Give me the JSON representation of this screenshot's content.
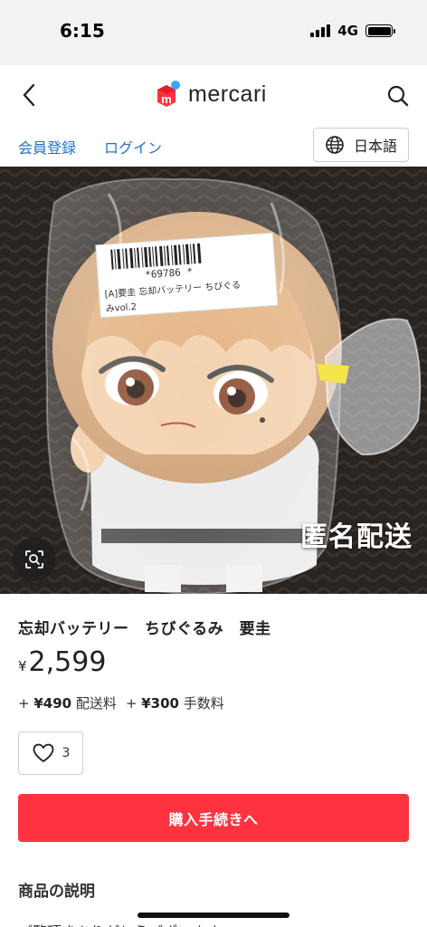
{
  "status_bar": {
    "time": "6:15",
    "network": "4G"
  },
  "header": {
    "logo_text": "mercari",
    "logo_mark": "m"
  },
  "subnav": {
    "register": "会員登録",
    "login": "ログイン",
    "language": "日本語"
  },
  "image": {
    "overlay_text": "匿名配送",
    "tag_line1": "*69786       *",
    "tag_line2": "[A]要圭  忘却バッテリー ちびぐる",
    "tag_line3": "みvol.2"
  },
  "product": {
    "title": "忘却バッテリー　ちびぐるみ　要圭",
    "currency": "¥",
    "price": "2,599",
    "shipping_prefix": "+ ",
    "shipping_amount": "¥490",
    "shipping_label": " 配送料",
    "fee_prefix": "+ ",
    "fee_amount": "¥300",
    "fee_label": " 手数料",
    "likes": "3"
  },
  "buy_button": "購入手続きへ",
  "description": {
    "heading": "商品の説明",
    "text": "ご覧頂きありがとうございます。"
  },
  "colors": {
    "accent": "#ff333f",
    "link": "#2273c7",
    "logo_red": "#ff333f",
    "logo_blue": "#3aa6ff"
  }
}
